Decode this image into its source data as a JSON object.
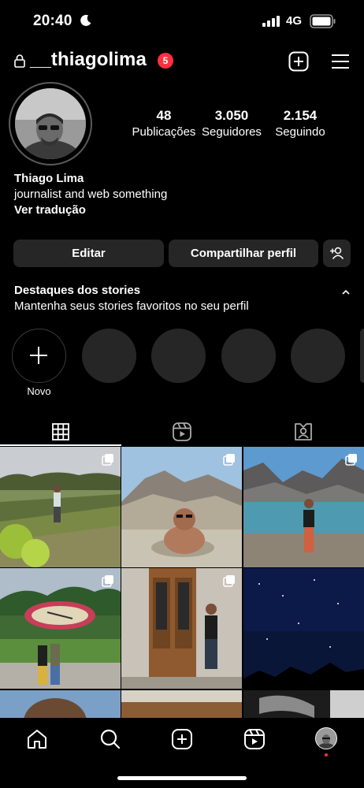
{
  "status_bar": {
    "time": "20:40",
    "network": "4G",
    "icons": [
      "moon-icon",
      "signal-icon",
      "battery-icon"
    ]
  },
  "header": {
    "username": "__thiagolima",
    "notification_count": "5",
    "icons": [
      "lock-icon",
      "new-post-icon",
      "menu-icon"
    ]
  },
  "profile": {
    "stats": [
      {
        "value": "48",
        "label": "Publicações"
      },
      {
        "value": "3.050",
        "label": "Seguidores"
      },
      {
        "value": "2.154",
        "label": "Seguindo"
      }
    ],
    "name": "Thiago Lima",
    "bio": "journalist and web something",
    "translate_link": "Ver tradução"
  },
  "actions": {
    "edit_label": "Editar",
    "share_label": "Compartilhar perfil"
  },
  "highlights": {
    "title": "Destaques dos stories",
    "subtitle": "Mantenha seus stories favoritos no seu perfil",
    "new_label": "Novo"
  },
  "tabs": [
    "grid-icon",
    "reels-icon",
    "tagged-icon"
  ],
  "bottom_nav": [
    "home-icon",
    "search-icon",
    "create-icon",
    "reels-icon",
    "profile-avatar"
  ],
  "colors": {
    "background": "#000000",
    "button": "#262626",
    "badge": "#ff3040"
  }
}
